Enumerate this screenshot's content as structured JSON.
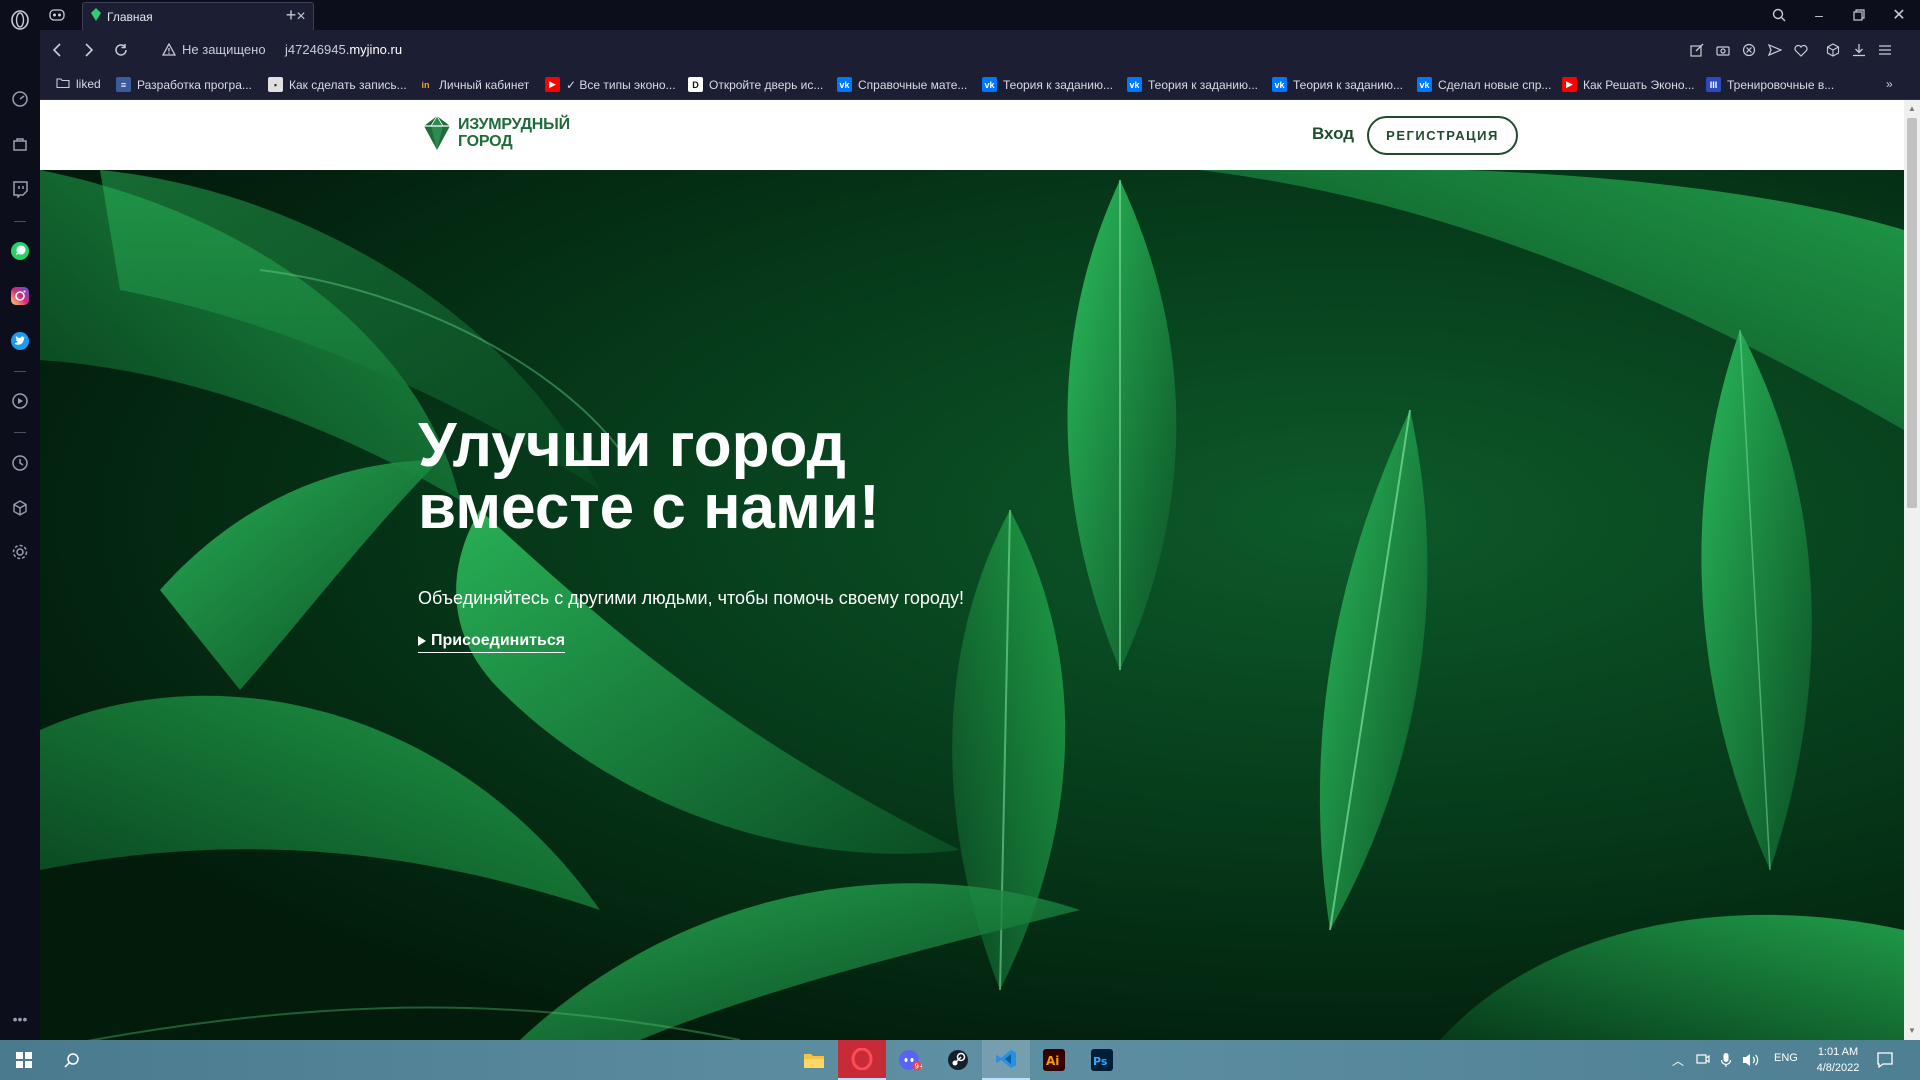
{
  "browser": {
    "tab": {
      "title": "Главная"
    },
    "address": {
      "security_label": "Не защищено",
      "url_prefix": "j47246945.",
      "url_domain": "myjino.ru"
    },
    "bookmarks": [
      {
        "label": "liked"
      },
      {
        "label": "Разработка програ..."
      },
      {
        "label": "Как сделать запись..."
      },
      {
        "label": "Личный кабинет"
      },
      {
        "label": "✓ Все типы эконо..."
      },
      {
        "label": "Откройте дверь ис..."
      },
      {
        "label": "Справочные мате..."
      },
      {
        "label": "Теория к заданию..."
      },
      {
        "label": "Теория к заданию..."
      },
      {
        "label": "Теория к заданию..."
      },
      {
        "label": "Сделал новые спр..."
      },
      {
        "label": "Как Решать Эконо..."
      },
      {
        "label": "Тренировочные в..."
      }
    ]
  },
  "site": {
    "logo_line1": "ИЗУМРУДНЫЙ",
    "logo_line2": "ГОРОД",
    "login_label": "Вход",
    "register_label": "РЕГИСТРАЦИЯ",
    "hero_title_line1": "Улучши город",
    "hero_title_line2": "вместе с нами!",
    "hero_subtitle": "Объединяйтесь с другими людьми, чтобы помочь своему городу!",
    "hero_cta": "Присоединиться"
  },
  "taskbar": {
    "lang": "ENG",
    "time": "1:01 AM",
    "date": "4/8/2022"
  },
  "colors": {
    "brand_green": "#1f4d2e",
    "browser_dark": "#1c1f33"
  }
}
